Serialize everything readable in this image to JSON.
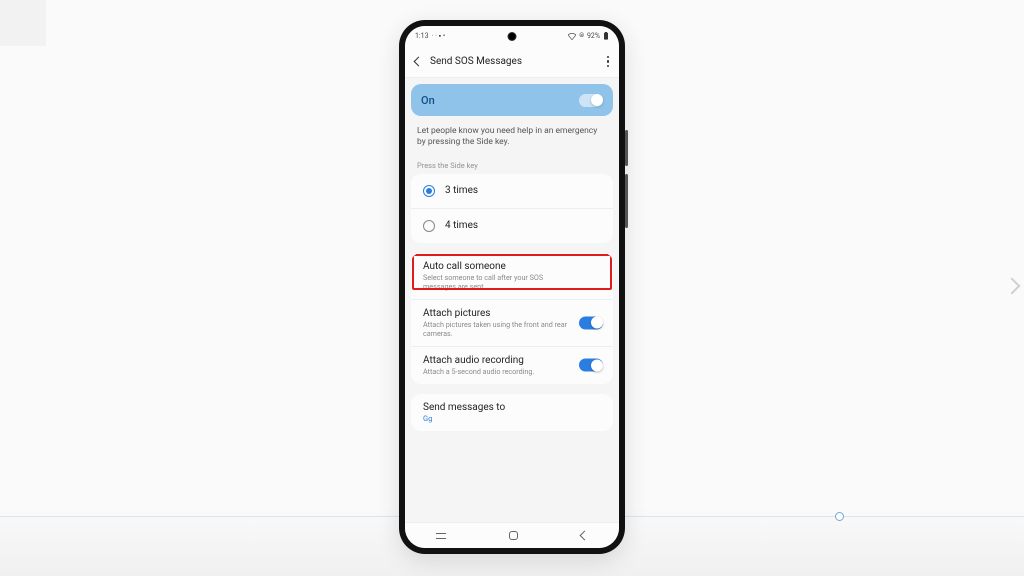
{
  "statusbar": {
    "time": "1:13",
    "battery": "92%"
  },
  "header": {
    "title": "Send SOS Messages"
  },
  "master_toggle": {
    "label": "On",
    "state": true
  },
  "description": "Let people know you need help in an emergency by pressing the Side key.",
  "press_section_label": "Press the Side key",
  "press_options": [
    {
      "label": "3 times",
      "selected": true
    },
    {
      "label": "4 times",
      "selected": false
    }
  ],
  "settings": {
    "auto_call": {
      "title": "Auto call someone",
      "sub": "Select someone to call after your SOS messages are sent."
    },
    "attach_pictures": {
      "title": "Attach pictures",
      "sub": "Attach pictures taken using the front and rear cameras.",
      "state": true
    },
    "attach_audio": {
      "title": "Attach audio recording",
      "sub": "Attach a 5-second audio recording.",
      "state": true
    },
    "send_to": {
      "title": "Send messages to",
      "value": "Gg"
    }
  }
}
